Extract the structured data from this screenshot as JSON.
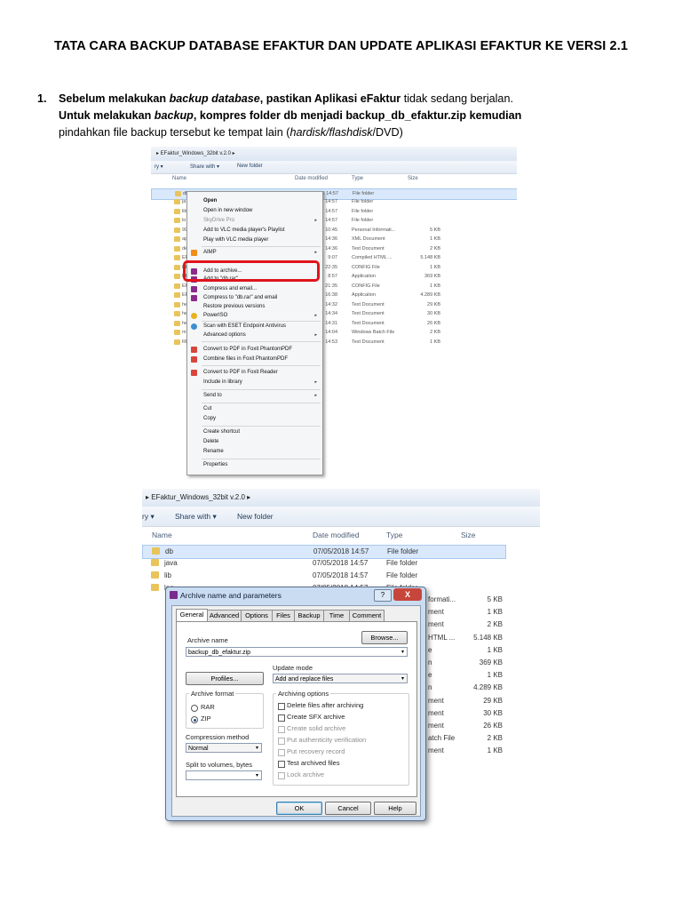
{
  "document": {
    "title": "TATA CARA BACKUP DATABASE EFAKTUR DAN UPDATE APLIKASI EFAKTUR KE VERSI 2.1",
    "step1": {
      "number": "1.",
      "line1_a": "Sebelum melakukan ",
      "line1_b": "backup database",
      "line1_c": ", pastikan Aplikasi eFaktur ",
      "line1_d": "tidak sedang berjalan.",
      "line2_a": "Untuk melakukan ",
      "line2_b": "backup",
      "line2_c": ", kompres folder db menjadi backup_db_efaktur.zip kemudian",
      "line3_a": "pindahkan file backup tersebut ke tempat lain (",
      "line3_b": "hardisk/flashdisk",
      "line3_c": "/DVD)"
    }
  },
  "shot1": {
    "breadcrumb": "▸ EFaktur_Windows_32bit v.2.0 ▸",
    "toolbar": {
      "organize": "ry ▾",
      "share": "Share with ▾",
      "new_folder": "New folder"
    },
    "columns": {
      "name": "Name",
      "date": "Date modified",
      "type": "Type",
      "size": "Size"
    },
    "rows": [
      {
        "n": "db",
        "d": "07/05/2018 14:57",
        "t": "File folder",
        "s": ""
      },
      {
        "n": "ja",
        "d": "14:57",
        "t": "File folder",
        "s": ""
      },
      {
        "n": "lib",
        "d": "14:57",
        "t": "File folder",
        "s": ""
      },
      {
        "n": "lo",
        "d": "14:57",
        "t": "File folder",
        "s": ""
      },
      {
        "n": "99",
        "d": "10:45",
        "t": "Personal Informati...",
        "s": "5 KB"
      },
      {
        "n": "ap",
        "d": "14:36",
        "t": "XML Document",
        "s": "1 KB"
      },
      {
        "n": "de",
        "d": "14:36",
        "t": "Text Document",
        "s": "2 KB"
      },
      {
        "n": "EF",
        "d": "9:07",
        "t": "Compiled HTML ...",
        "s": "5.148 KB"
      },
      {
        "n": "EF",
        "d": "22:35",
        "t": "CONFIG File",
        "s": "1 KB"
      },
      {
        "n": "EF",
        "d": "8:57",
        "t": "Application",
        "s": "369 KB"
      },
      {
        "n": "EF",
        "d": "21:35",
        "t": "CONFIG File",
        "s": "1 KB"
      },
      {
        "n": "EF",
        "d": "16:38",
        "t": "Application",
        "s": "4.289 KB"
      },
      {
        "n": "he",
        "d": "14:32",
        "t": "Text Document",
        "s": "29 KB"
      },
      {
        "n": "he",
        "d": "14:34",
        "t": "Text Document",
        "s": "30 KB"
      },
      {
        "n": "he",
        "d": "14:31",
        "t": "Text Document",
        "s": "26 KB"
      },
      {
        "n": "m",
        "d": "14:04",
        "t": "Windows Batch File",
        "s": "2 KB"
      },
      {
        "n": "RE",
        "d": "14:53",
        "t": "Text Document",
        "s": "1 KB"
      }
    ],
    "menu": {
      "open": "Open",
      "open_new": "Open in new window",
      "skydrive": "SkyDrive Pro",
      "vlc_add": "Add to VLC media player's Playlist",
      "vlc_play": "Play with VLC media player",
      "aimp": "AIMP",
      "add_archive": "Add to archive...",
      "add_db_rar": "Add to \"db.rar\"",
      "compress_email": "Compress and email...",
      "compress_db_email": "Compress to \"db.rar\" and email",
      "restore": "Restore previous versions",
      "poweriso": "PowerISO",
      "eset": "Scan with ESET Endpoint Antivirus",
      "advanced": "Advanced options",
      "foxit_convert": "Convert to PDF in Foxit PhantomPDF",
      "foxit_combine": "Combine files in Foxit PhantomPDF",
      "foxit_reader": "Convert to PDF in Foxit Reader",
      "library": "Include in library",
      "send_to": "Send to",
      "cut": "Cut",
      "copy": "Copy",
      "shortcut": "Create shortcut",
      "delete": "Delete",
      "rename": "Rename",
      "properties": "Properties"
    }
  },
  "shot2": {
    "breadcrumb": "▸ EFaktur_Windows_32bit v.2.0 ▸",
    "toolbar": {
      "organize": "ry ▾",
      "share": "Share with ▾",
      "new_folder": "New folder"
    },
    "columns": {
      "name": "Name",
      "date": "Date modified",
      "type": "Type",
      "size": "Size"
    },
    "rows": [
      {
        "n": "db",
        "d": "07/05/2018 14:57",
        "t": "File folder"
      },
      {
        "n": "java",
        "d": "07/05/2018 14:57",
        "t": "File folder"
      },
      {
        "n": "lib",
        "d": "07/05/2018 14:57",
        "t": "File folder"
      },
      {
        "n": "log",
        "d": "07/05/2018 14:57",
        "t": "File folder"
      }
    ],
    "right_rows": [
      {
        "t": "formati...",
        "s": "5 KB"
      },
      {
        "t": "ment",
        "s": "1 KB"
      },
      {
        "t": "ment",
        "s": "2 KB"
      },
      {
        "t": "HTML ...",
        "s": "5.148 KB"
      },
      {
        "t": "e",
        "s": "1 KB"
      },
      {
        "t": "n",
        "s": "369 KB"
      },
      {
        "t": "e",
        "s": "1 KB"
      },
      {
        "t": "n",
        "s": "4.289 KB"
      },
      {
        "t": "ment",
        "s": "29 KB"
      },
      {
        "t": "ment",
        "s": "30 KB"
      },
      {
        "t": "ment",
        "s": "26 KB"
      },
      {
        "t": "atch File",
        "s": "2 KB"
      },
      {
        "t": "ment",
        "s": "1 KB"
      }
    ],
    "dialog": {
      "title": "Archive name and parameters",
      "help_q": "?",
      "close": "X",
      "tabs": [
        "General",
        "Advanced",
        "Options",
        "Files",
        "Backup",
        "Time",
        "Comment"
      ],
      "archive_name_label": "Archive name",
      "browse": "Browse...",
      "archive_name_value": "backup_db_efaktur.zip",
      "profiles": "Profiles...",
      "update_mode_label": "Update mode",
      "update_mode_value": "Add and replace files",
      "archive_format_label": "Archive format",
      "rar": "RAR",
      "zip": "ZIP",
      "archiving_options_label": "Archiving options",
      "opt_delete": "Delete files after archiving",
      "opt_sfx": "Create SFX archive",
      "opt_solid": "Create solid archive",
      "opt_auth": "Put authenticity verification",
      "opt_recovery": "Put recovery record",
      "opt_test": "Test archived files",
      "opt_lock": "Lock archive",
      "compression_label": "Compression method",
      "compression_value": "Normal",
      "split_label": "Split to volumes, bytes",
      "ok": "OK",
      "cancel": "Cancel",
      "help": "Help"
    }
  }
}
